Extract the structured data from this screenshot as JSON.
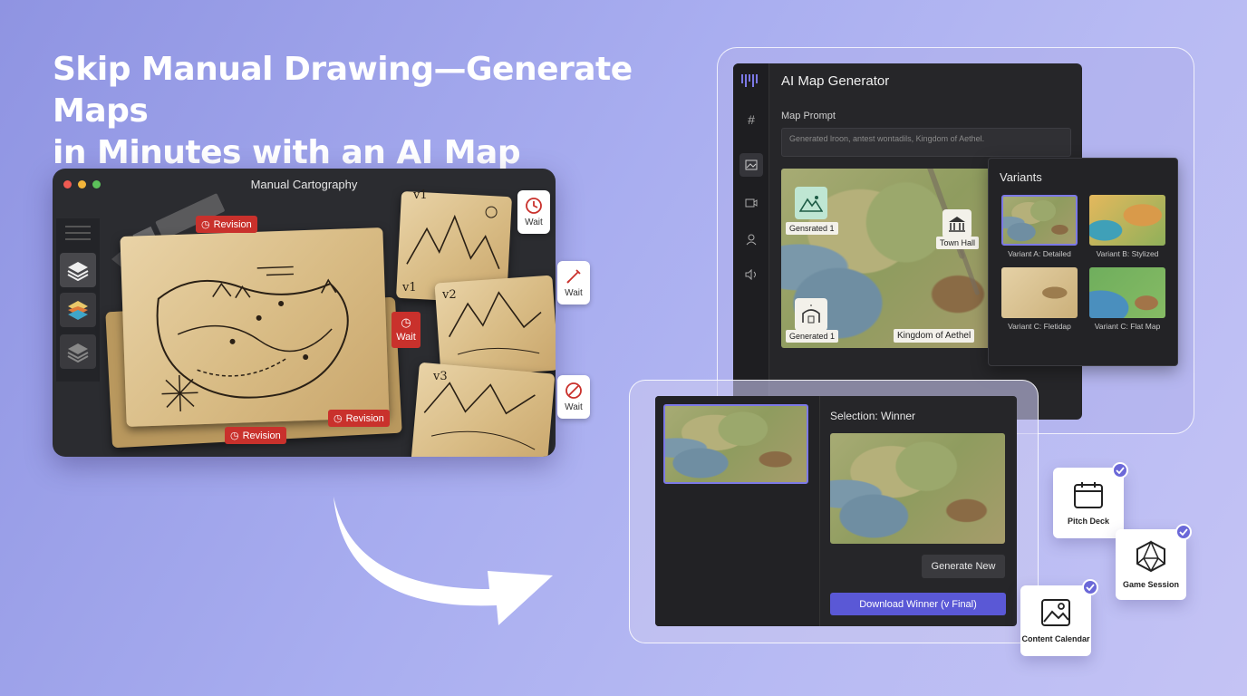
{
  "headline": {
    "line1": "Skip Manual Drawing—Generate Maps",
    "line2": "in Minutes with an AI Map Generator."
  },
  "manual_window": {
    "title": "Manual Cartography",
    "revision_labels": [
      "Revision",
      "Revision",
      "Revision"
    ],
    "wait_label": "Wait",
    "version_labels": [
      "v1",
      "v1",
      "v2",
      "v3"
    ]
  },
  "ai_app": {
    "title": "AI Map Generator",
    "prompt_label": "Map Prompt",
    "prompt_value": "Generated lroon, antest wontadils, Kingdom of Aethel.",
    "map_labels": {
      "generated_top": "Gensrated 1",
      "generated_bottom": "Generated 1",
      "town_hall": "Town Hall",
      "kingdom": "Kingdom of Aethel"
    }
  },
  "variants": {
    "title": "Variants",
    "items": [
      {
        "caption": "Variant A: Detailed"
      },
      {
        "caption": "Variant B: Stylized"
      },
      {
        "caption": "Variant C: Fletidap"
      },
      {
        "caption": "Variant C: Flat Map"
      }
    ]
  },
  "selection": {
    "title": "Selection: Winner",
    "generate_new": "Generate New",
    "download": "Download Winner (v Final)"
  },
  "cards": {
    "pitch_deck": "Pitch Deck",
    "game_session": "Game Session",
    "content_calendar": "Content Calendar"
  },
  "colors": {
    "accent": "#5a58d6",
    "revision_red": "#c9312c",
    "check_purple": "#6b68d8"
  }
}
